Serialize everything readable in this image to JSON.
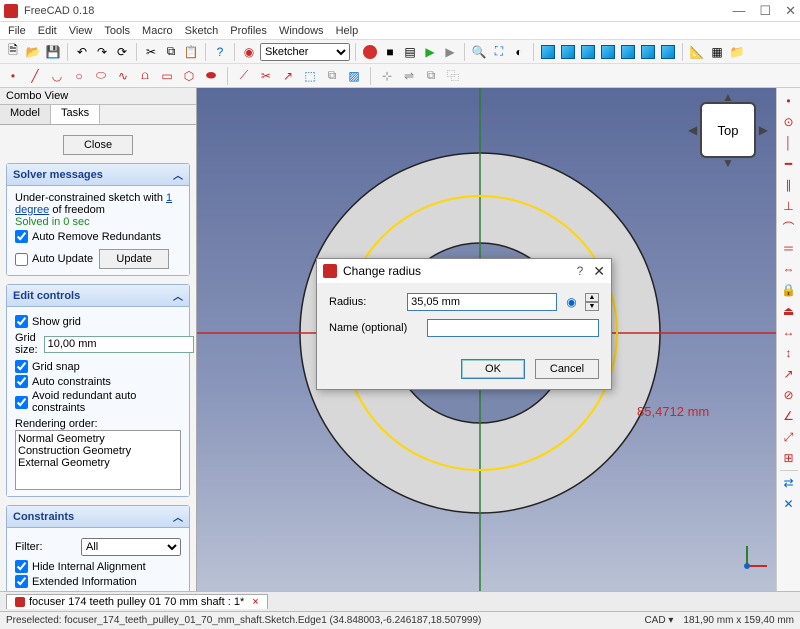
{
  "window": {
    "title": "FreeCAD 0.18"
  },
  "menu": {
    "items": [
      "File",
      "Edit",
      "View",
      "Tools",
      "Macro",
      "Sketch",
      "Profiles",
      "Windows",
      "Help"
    ]
  },
  "workbench": {
    "selected": "Sketcher"
  },
  "combo": {
    "header": "Combo View",
    "tabs": {
      "model": "Model",
      "tasks": "Tasks"
    },
    "close": "Close"
  },
  "solver": {
    "title": "Solver messages",
    "msg_prefix": "Under-constrained sketch with ",
    "msg_link": "1 degree",
    "msg_suffix": " of freedom",
    "solved": "Solved in 0 sec",
    "auto_remove": "Auto Remove Redundants",
    "auto_update": "Auto Update",
    "update_btn": "Update"
  },
  "edit": {
    "title": "Edit controls",
    "show_grid": "Show grid",
    "grid_size_label": "Grid size:",
    "grid_size_value": "10,00 mm",
    "grid_snap": "Grid snap",
    "auto_constraints": "Auto constraints",
    "avoid_redundant": "Avoid redundant auto constraints",
    "rendering_label": "Rendering order:",
    "rendering_items": [
      "Normal Geometry",
      "Construction Geometry",
      "External Geometry"
    ]
  },
  "constraints": {
    "title": "Constraints",
    "filter_label": "Filter:",
    "filter_value": "All",
    "hide_internal": "Hide Internal Alignment",
    "extended_info": "Extended Information"
  },
  "dialog": {
    "title": "Change radius",
    "radius_label": "Radius:",
    "radius_value": "35,05 mm",
    "name_label": "Name (optional)",
    "name_value": "",
    "ok": "OK",
    "cancel": "Cancel"
  },
  "viewport": {
    "nav_cube_face": "Top",
    "dimension_text": "85,4712 mm"
  },
  "document": {
    "tab_label": "focuser 174 teeth pulley 01 70 mm shaft : 1*"
  },
  "status": {
    "preselected": "Preselected: focuser_174_teeth_pulley_01_70_mm_shaft.Sketch.Edge1 (34.848003,-6.246187,18.507999)",
    "cad_label": "CAD",
    "dims": "181,90 mm x 159,40 mm"
  }
}
